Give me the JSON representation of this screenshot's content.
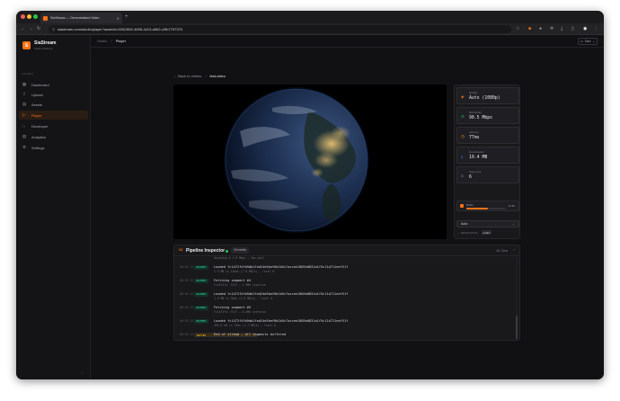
{
  "browser": {
    "tab_title": "SiaStream — Decentralized Video",
    "url": "siastream.com/studio/player?assetId=02813f92-4695-4413-a562-c3fb7757370"
  },
  "brand": {
    "name": "SiaStream",
    "subtitle": "Studio Platform",
    "logo_letter": "S"
  },
  "sidebar": {
    "section": "STUDIO",
    "items": [
      {
        "label": "Dashboard",
        "icon": "dashboard-icon",
        "active": false
      },
      {
        "label": "Upload",
        "icon": "upload-icon",
        "active": false
      },
      {
        "label": "Assets",
        "icon": "assets-icon",
        "active": false
      },
      {
        "label": "Player",
        "icon": "play-icon",
        "active": true
      },
      {
        "label": "Developer",
        "icon": "code-icon",
        "active": false
      },
      {
        "label": "Analytics",
        "icon": "analytics-icon",
        "active": false
      },
      {
        "label": "Settings",
        "icon": "gear-icon",
        "active": false
      }
    ]
  },
  "topbar": {
    "crumb_root": "Studio",
    "crumb_sep": "/",
    "crumb_current": "Player",
    "dev_label": "Dev"
  },
  "player": {
    "back_label": "Back to videos",
    "sep": "/",
    "video_name": "test-video"
  },
  "stats": {
    "items": [
      {
        "label": "Quality",
        "value": "Auto (1080p)",
        "icon": "quality-icon",
        "color": "#f97316"
      },
      {
        "label": "Bandwidth",
        "value": "90.5 Mbps",
        "icon": "wifi-icon",
        "color": "#22c55e"
      },
      {
        "label": "Latency",
        "value": "77ms",
        "icon": "clock-icon",
        "color": "#f59e0b"
      },
      {
        "label": "Downloaded",
        "value": "19.4 MB",
        "icon": "download-icon",
        "color": "#3b82f6"
      },
      {
        "label": "Segments",
        "value": "6",
        "icon": "layers-icon",
        "color": "#a78bfa"
      }
    ],
    "buffer_label": "Buffer",
    "buffer_value": "31.8s",
    "buffer_fill": 0.55,
    "quality_select": "Auto",
    "renditions_label": "RENDITIONS",
    "renditions_badge": "public"
  },
  "inspector": {
    "title": "Pipeline Inspector",
    "event_count": "16 events",
    "clear_label": "Clear",
    "partial_top": "decoding & 4.0 Mbps — 1ms wait",
    "logs": [
      {
        "ts": "00:01:12",
        "tag": "SEGMENT",
        "type": "segment",
        "msg": "Loaded fc1472f4fb9db1fed24e5bef6b1b5c7accee1805e0831a1f5c11d711eef51f",
        "sub": "1.9 MB in 156ms (7.0 MB/s) — level 0"
      },
      {
        "ts": "00:01:12",
        "tag": "SEGMENT",
        "type": "segment",
        "msg": "Fetching segment #4",
        "sub": "fc1472f4..f51f — 1.9Mb localise"
      },
      {
        "ts": "00:01:12",
        "tag": "SEGMENT",
        "type": "segment",
        "msg": "Loaded fc1472f4fb9db1fed24e5bef6b1b5c7accee1805e0831a1f5c11d711eef51f",
        "sub": "1.9 MB in 94ms (2.0 MB/s) — level 0"
      },
      {
        "ts": "00:01:12",
        "tag": "SEGMENT",
        "type": "segment",
        "msg": "Fetching segment #5",
        "sub": "fc1472f4..f51f — 0.4Mb overscan"
      },
      {
        "ts": "00:01:12",
        "tag": "SEGMENT",
        "type": "segment",
        "msg": "Loaded fc1472f4fb9db1fed24e5bef6b1b5c7accee1805e0831a1f5c11d711eef51f",
        "sub": "495.8 kB in 75ms (1.7 MB/s) — level 0"
      },
      {
        "ts": "00:01:12",
        "tag": "BUFFER",
        "type": "buffer",
        "msg": "End of stream — all segments buffered",
        "sub": ""
      }
    ]
  }
}
